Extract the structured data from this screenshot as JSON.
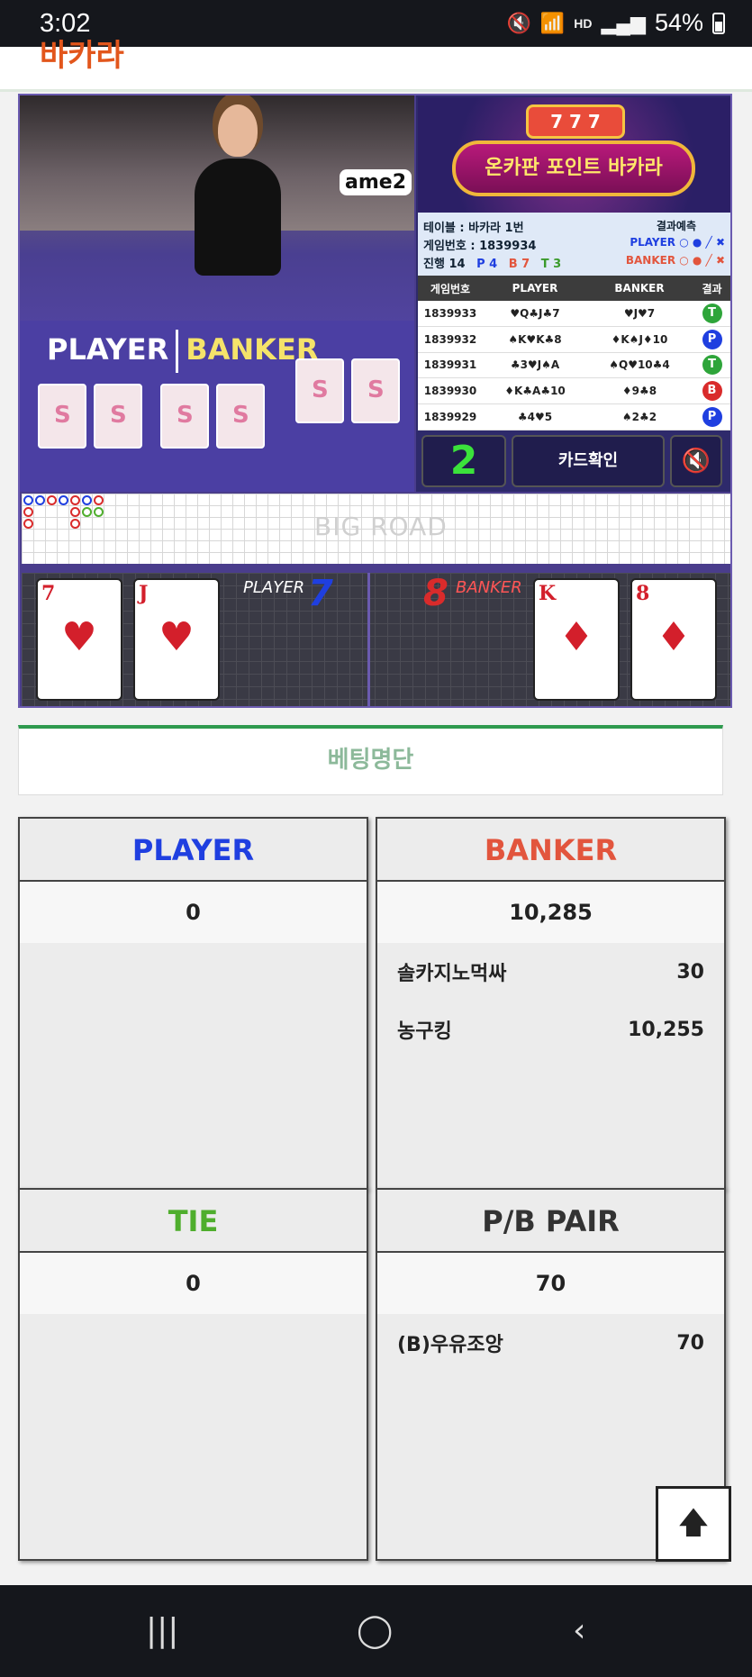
{
  "status_bar": {
    "time": "3:02",
    "battery": "54%",
    "network": "HD"
  },
  "header": {
    "title": "바카라"
  },
  "video": {
    "table_tag": "ame2",
    "felt_player": "PLAYER",
    "felt_banker": "BANKER"
  },
  "banner": {
    "slot": "7 7 7",
    "title": "온카판 포인트 바카라"
  },
  "info": {
    "table": "테이블 : 바카라 1번",
    "game_no": "게임번호 : 1839934",
    "progress_label": "진행 14",
    "progress_p": "P 4",
    "progress_b": "B 7",
    "progress_t": "T 3",
    "prediction_label": "결과예측",
    "pred_player": "PLAYER",
    "pred_banker": "BANKER"
  },
  "results_table": {
    "headers": [
      "게임번호",
      "PLAYER",
      "BANKER",
      "결과"
    ],
    "rows": [
      {
        "no": "1839933",
        "player": "♥Q♣J♣7",
        "banker": "♥J♥7",
        "result": "T"
      },
      {
        "no": "1839932",
        "player": "♠K♥K♣8",
        "banker": "♦K♠J♦10",
        "result": "P"
      },
      {
        "no": "1839931",
        "player": "♣3♥J♠A",
        "banker": "♠Q♥10♣4",
        "result": "T"
      },
      {
        "no": "1839930",
        "player": "♦K♣A♣10",
        "banker": "♦9♣8",
        "result": "B"
      },
      {
        "no": "1839929",
        "player": "♣4♥5",
        "banker": "♠2♣2",
        "result": "P"
      }
    ]
  },
  "controls": {
    "count": "2",
    "card_check": "카드확인",
    "mute": "🔇"
  },
  "bigroad": {
    "label": "BIG ROAD"
  },
  "cards": {
    "player_label": "PLAYER",
    "player_score": "7",
    "banker_label": "BANKER",
    "banker_score": "8",
    "player_cards": [
      {
        "rank": "7",
        "suit": "♥"
      },
      {
        "rank": "J",
        "suit": "♥"
      }
    ],
    "banker_cards": [
      {
        "rank": "K",
        "suit": "♦"
      },
      {
        "rank": "8",
        "suit": "♦"
      }
    ]
  },
  "betting": {
    "title": "베팅명단",
    "player": {
      "label": "PLAYER",
      "total": "0"
    },
    "banker": {
      "label": "BANKER",
      "total": "10,285",
      "entries": [
        {
          "name": "솔카지노먹싸",
          "amount": "30"
        },
        {
          "name": "농구킹",
          "amount": "10,255"
        }
      ]
    },
    "tie": {
      "label": "TIE",
      "total": "0"
    },
    "pair": {
      "label": "P/B PAIR",
      "total": "70",
      "entries": [
        {
          "name": "(B)우유조앙",
          "amount": "70"
        }
      ]
    }
  },
  "scroll_top": "🡅",
  "colors": {
    "player": "#1f3fe0",
    "banker": "#e2553d",
    "tie": "#4fae2d",
    "accent": "#2e9a4e"
  }
}
